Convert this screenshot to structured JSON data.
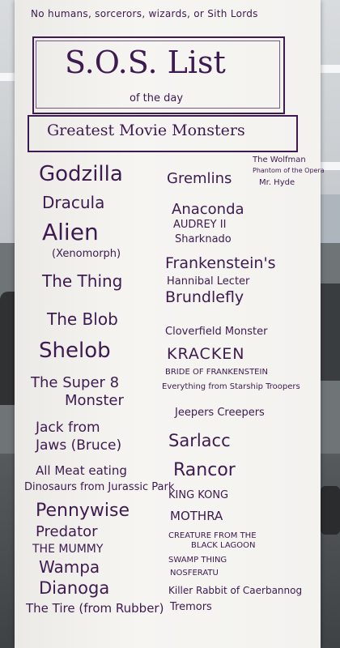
{
  "board": {
    "top_note": "No humans, sorcerors, wizards, or Sith Lords",
    "title": "S.O.S. List",
    "subtitle": "of the day",
    "theme": "Greatest Movie Monsters"
  },
  "left_column": [
    "Godzilla",
    "Dracula",
    "Alien",
    "(Xenomorph)",
    "The Thing",
    "The Blob",
    "Shelob",
    "The Super 8",
    "Monster",
    "Jack from",
    "Jaws (Bruce)",
    "All Meat eating",
    "Dinosaurs from Jurassic Park",
    "Pennywise",
    "Predator",
    "THE MUMMY",
    "Wampa",
    "Dianoga",
    "The Tire (from Rubber)"
  ],
  "right_column": [
    "The Wolfman",
    "Phantom of the Opera",
    "Mr. Hyde",
    "Gremlins",
    "Anaconda",
    "AUDREY II",
    "Sharknado",
    "Frankenstein's",
    "Hannibal Lecter",
    "Brundlefly",
    "Cloverfield Monster",
    "KRACKEN",
    "BRIDE OF FRANKENSTEIN",
    "Everything from Starship Troopers",
    "Jeepers Creepers",
    "Sarlacc",
    "Rancor",
    "KING KONG",
    "MOTHRA",
    "CREATURE FROM THE",
    "BLACK LAGOON",
    "SWAMP THING",
    "NOSFERATU",
    "Killer Rabbit of Caerbannog",
    "Tremors"
  ]
}
